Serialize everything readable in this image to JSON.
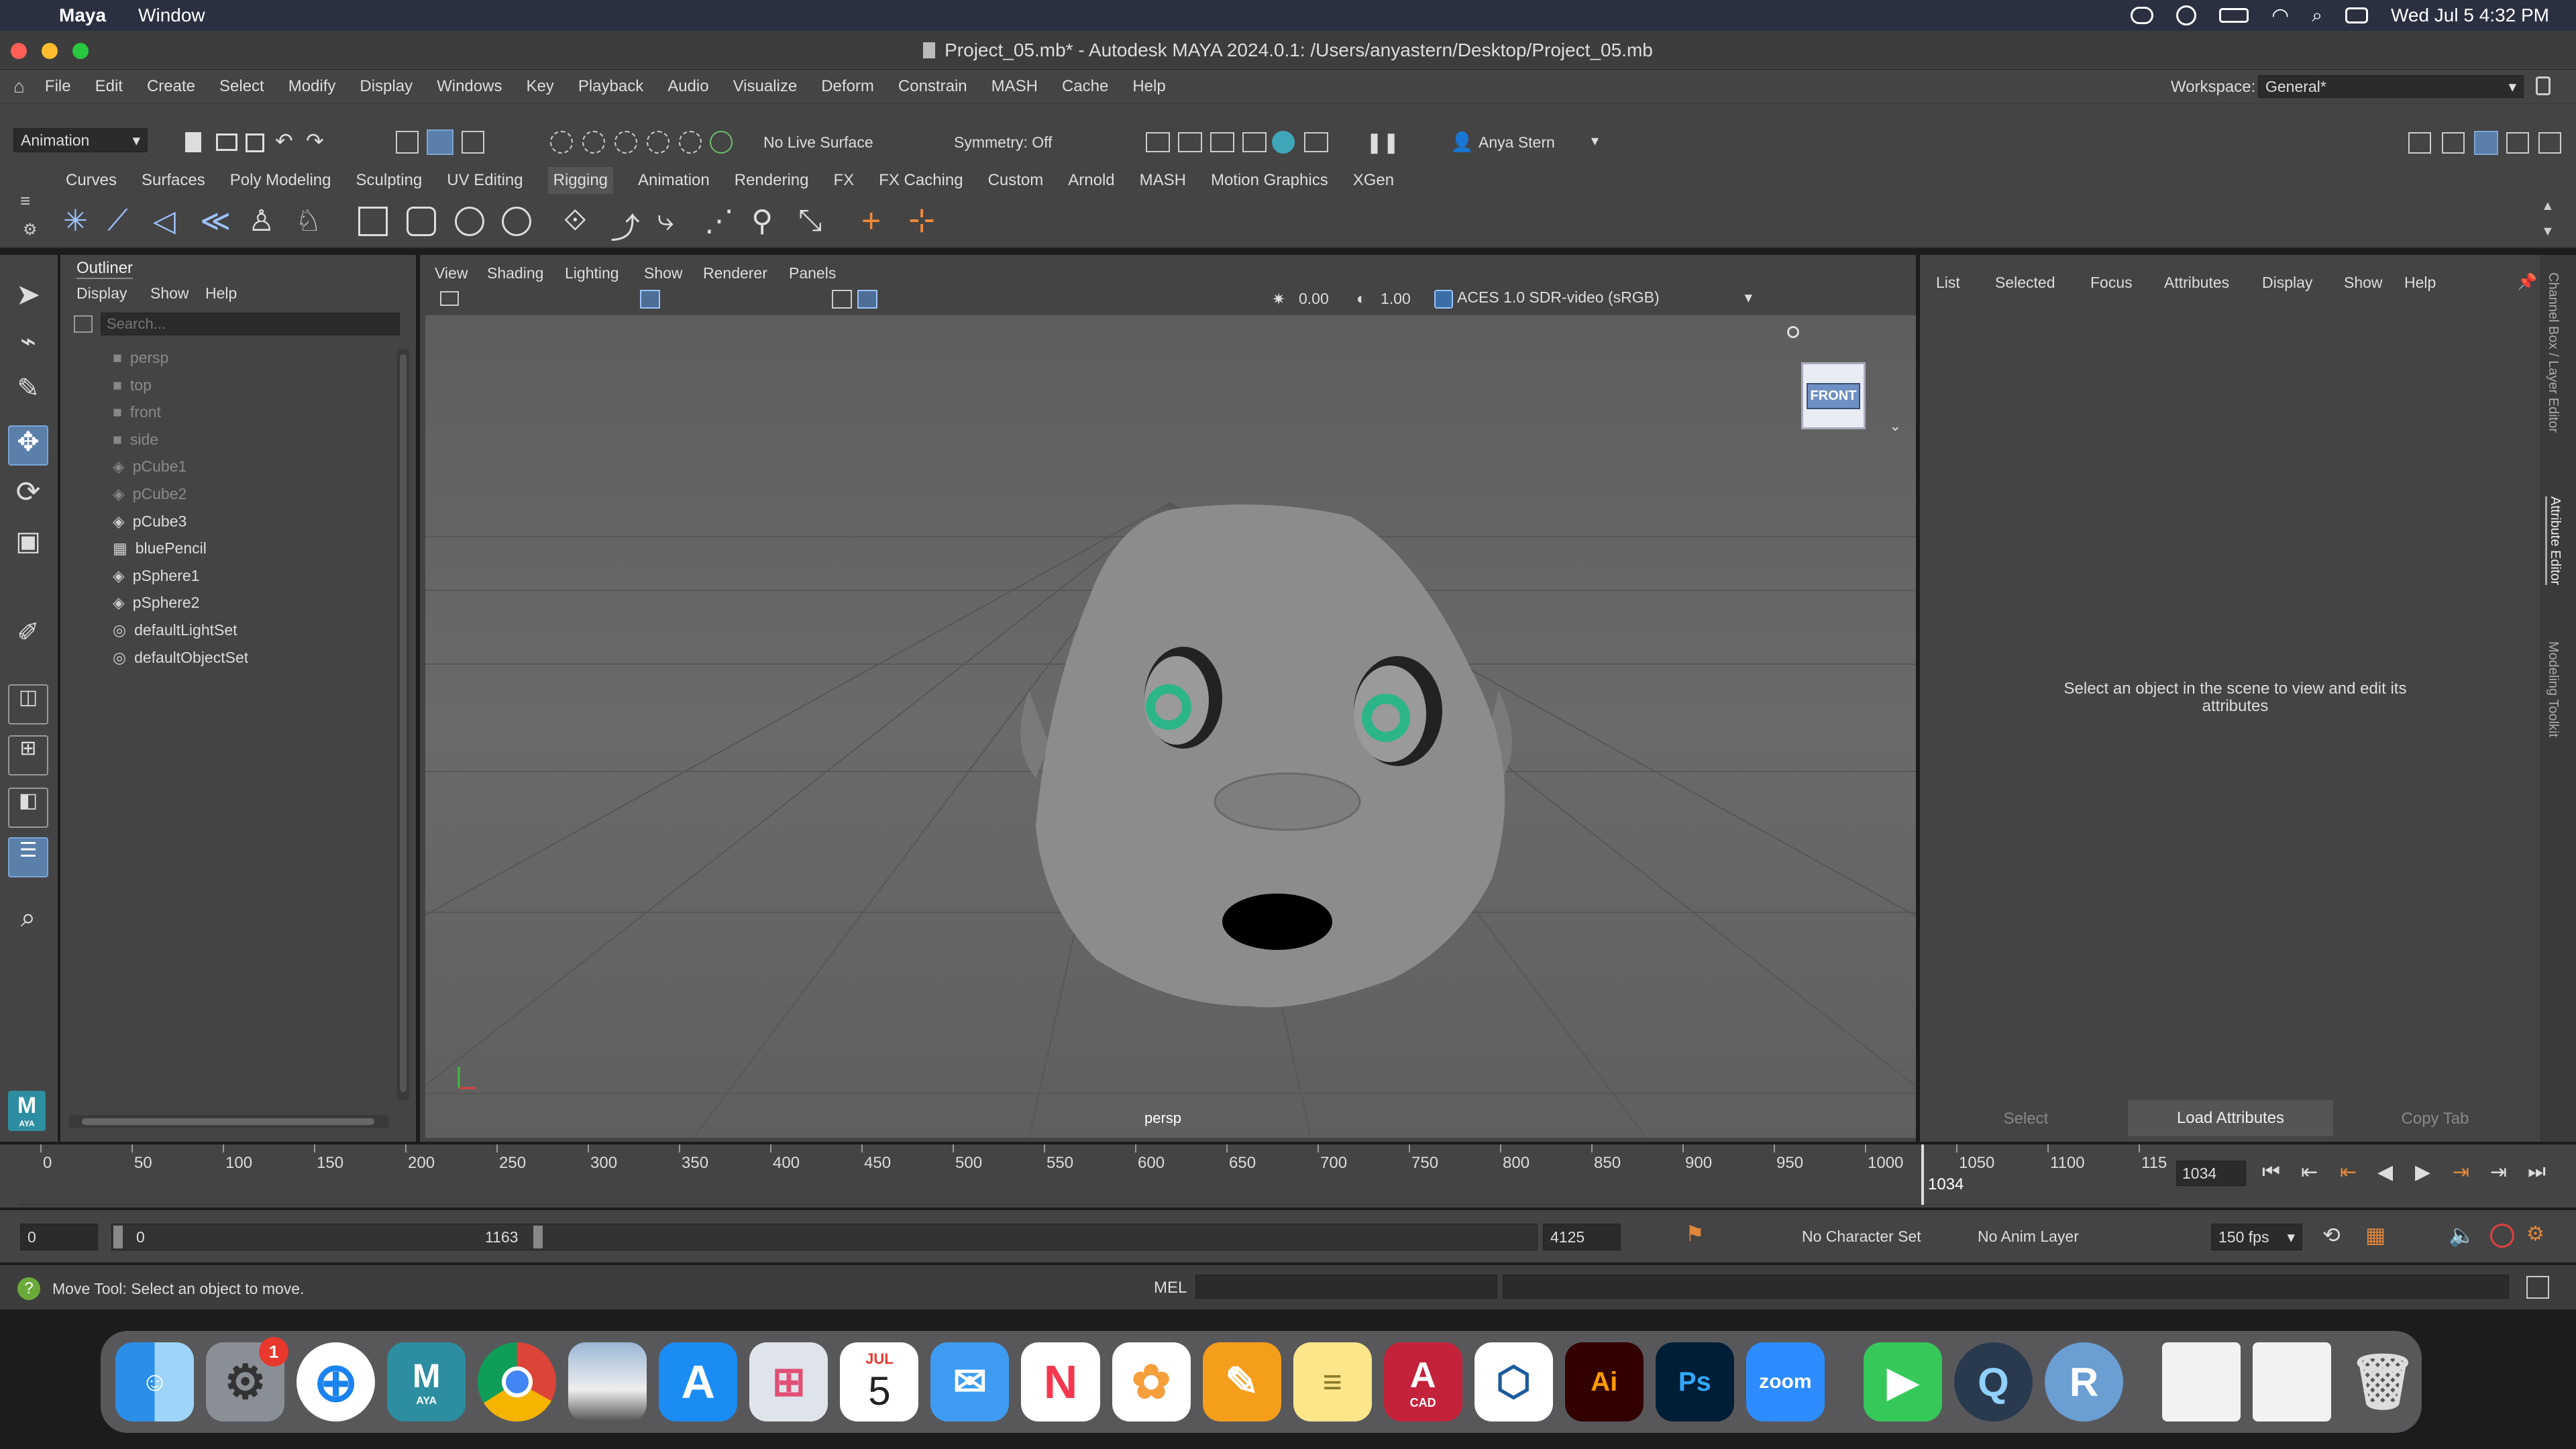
{
  "macmenu": {
    "app": "Maya",
    "window": "Window",
    "datetime": "Wed Jul 5  4:32 PM"
  },
  "window_title": "Project_05.mb* - Autodesk MAYA 2024.0.1: /Users/anyastern/Desktop/Project_05.mb",
  "menus": [
    "File",
    "Edit",
    "Create",
    "Select",
    "Modify",
    "Display",
    "Windows",
    "Key",
    "Playback",
    "Audio",
    "Visualize",
    "Deform",
    "Constrain",
    "MASH",
    "Cache",
    "Help"
  ],
  "workspace": {
    "label": "Workspace:",
    "value": "General*"
  },
  "status": {
    "mode": "Animation",
    "live_surface": "No Live Surface",
    "symmetry": "Symmetry: Off",
    "user": "Anya Stern"
  },
  "shelf_tabs": [
    "Curves",
    "Surfaces",
    "Poly Modeling",
    "Sculpting",
    "UV Editing",
    "Rigging",
    "Animation",
    "Rendering",
    "FX",
    "FX Caching",
    "Custom",
    "Arnold",
    "MASH",
    "Motion Graphics",
    "XGen"
  ],
  "outliner": {
    "title": "Outliner",
    "menus": [
      "Display",
      "Show",
      "Help"
    ],
    "search_placeholder": "Search...",
    "items": [
      {
        "name": "persp",
        "type": "camera",
        "dim": true
      },
      {
        "name": "top",
        "type": "camera",
        "dim": true
      },
      {
        "name": "front",
        "type": "camera",
        "dim": true
      },
      {
        "name": "side",
        "type": "camera",
        "dim": true
      },
      {
        "name": "pCube1",
        "type": "mesh",
        "dim": true
      },
      {
        "name": "pCube2",
        "type": "mesh",
        "dim": true
      },
      {
        "name": "pCube3",
        "type": "mesh",
        "dim": false
      },
      {
        "name": "bluePencil",
        "type": "pencil",
        "dim": false
      },
      {
        "name": "pSphere1",
        "type": "mesh",
        "dim": false
      },
      {
        "name": "pSphere2",
        "type": "mesh",
        "dim": false
      },
      {
        "name": "defaultLightSet",
        "type": "set",
        "dim": false
      },
      {
        "name": "defaultObjectSet",
        "type": "set",
        "dim": false
      }
    ]
  },
  "viewport": {
    "menus": [
      "View",
      "Shading",
      "Lighting",
      "Show",
      "Renderer",
      "Panels"
    ],
    "exposure": "0.00",
    "gamma": "1.00",
    "colorspace": "ACES 1.0 SDR-video (sRGB)",
    "camera": "persp",
    "viewcube": "FRONT"
  },
  "attribute_editor": {
    "menus": [
      "List",
      "Selected",
      "Focus",
      "Attributes",
      "Display",
      "Show",
      "Help"
    ],
    "message": "Select an object in the scene to view and edit its attributes",
    "buttons": [
      "Select",
      "Load Attributes",
      "Copy Tab"
    ]
  },
  "side_tabs": [
    "Channel Box / Layer Editor",
    "Attribute Editor",
    "Modeling Toolkit"
  ],
  "timeline": {
    "ticks": [
      "0",
      "50",
      "100",
      "150",
      "200",
      "250",
      "300",
      "350",
      "400",
      "450",
      "500",
      "550",
      "600",
      "650",
      "700",
      "750",
      "800",
      "850",
      "900",
      "950",
      "1000",
      "1050",
      "1100",
      "115"
    ],
    "current_frame": "1034",
    "current_frame_field": "1034"
  },
  "range": {
    "start": "0",
    "range_start": "0",
    "range_end": "1163",
    "end": "4125",
    "character_set": "No Character Set",
    "anim_layer": "No Anim Layer",
    "fps": "150 fps"
  },
  "helpline": {
    "message": "Move Tool: Select an object to move.",
    "mel": "MEL"
  },
  "dock": {
    "badge": "1",
    "calendar_month": "JUL",
    "calendar_day": "5",
    "maya_label": "AYA",
    "cad_label": "CAD",
    "ai": "Ai",
    "ps": "Ps",
    "zoom": "zoom"
  }
}
